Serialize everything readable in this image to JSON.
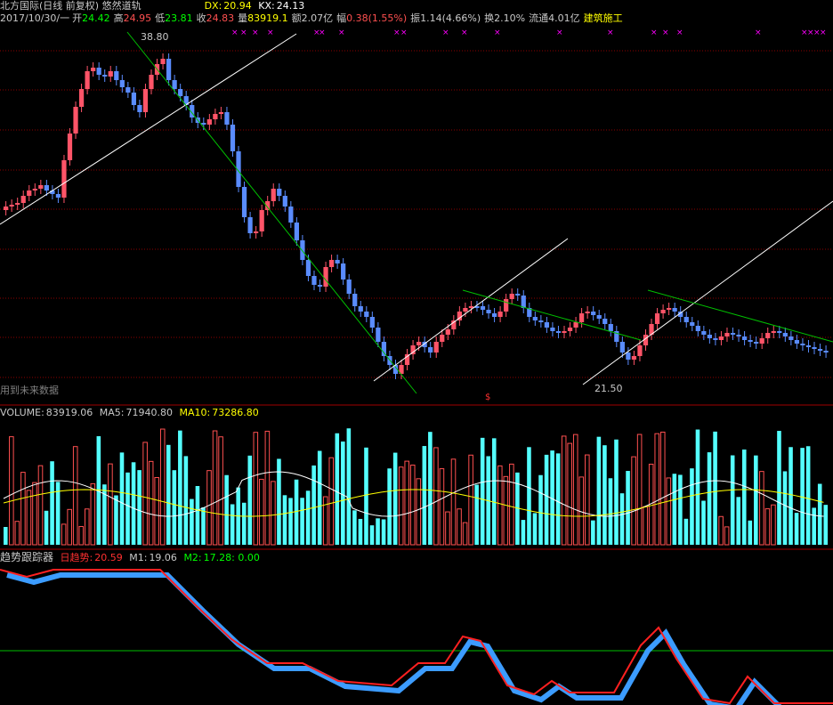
{
  "header": {
    "title": "北方国际(日线 前复权) 悠然道轨",
    "dx_label": "DX:",
    "dx_value": "20.94",
    "kx_label": "KX:",
    "kx_value": "24.13",
    "date": "2017/10/30/一",
    "open_label": "开",
    "open_value": "24.42",
    "high_label": "高",
    "high_value": "24.95",
    "low_label": "低",
    "low_value": "23.81",
    "close_label": "收",
    "close_value": "24.83",
    "vol_label": "量",
    "vol_value": "83919.1",
    "amount_label": "额",
    "amount_value": "2.07亿",
    "change_label": "幅",
    "change_value": "0.38(1.55%)",
    "amp_label": "振",
    "amp_value": "1.14(4.66%)",
    "turnover_label": "换",
    "turnover_value": "2.10%",
    "float_label": "流通",
    "float_value": "4.01亿",
    "sector": "建筑施工"
  },
  "price_panel": {
    "high_marker": "38.80",
    "low_marker": "21.50",
    "future_data_note": "用到未来数据",
    "signal_mark": "$"
  },
  "volume_panel": {
    "volume_label": "VOLUME:",
    "volume_value": "83919.06",
    "ma5_label": "MA5:",
    "ma5_value": "71940.80",
    "ma10_label": "MA10:",
    "ma10_value": "73286.80"
  },
  "trend_panel": {
    "title": "趋势跟踪器",
    "day_trend_label": "日趋势:",
    "day_trend_value": "20.59",
    "m1_label": "M1:",
    "m1_value": "19.06",
    "m2_label": "M2:",
    "m2_value": "17.28",
    "extra_value": ": 0.00"
  },
  "colors": {
    "up": "#ff5468",
    "down": "#5a8cff",
    "vol_up": "#ff5050",
    "vol_down": "#54ffff",
    "grid": "#8b0000",
    "trend_green": "#00c000",
    "magenta": "#ff00ff",
    "yellow": "#ffff00",
    "blue_fill": "#3c9cff"
  }
}
